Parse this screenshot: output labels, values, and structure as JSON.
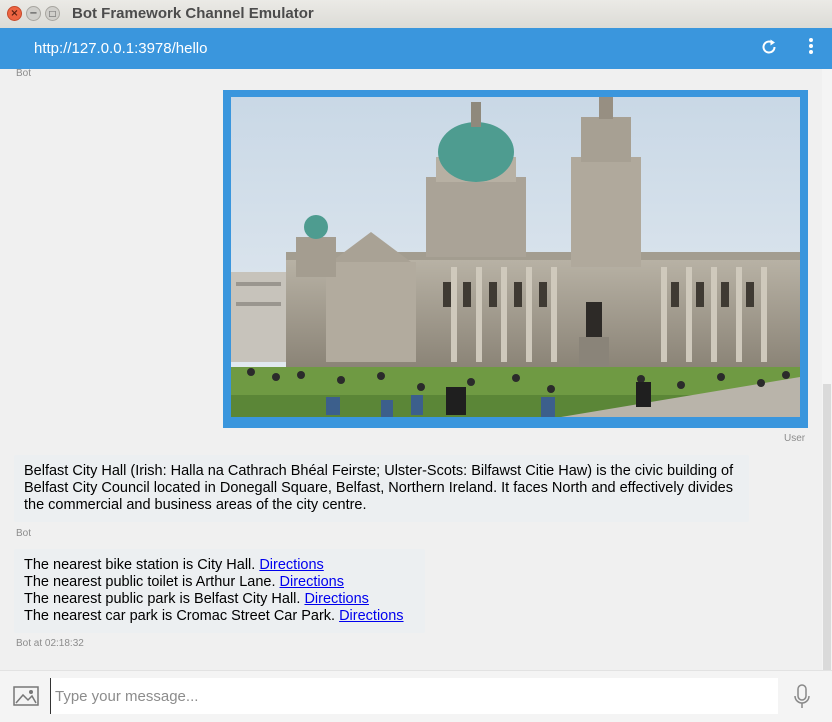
{
  "window": {
    "title": "Bot Framework Channel Emulator"
  },
  "address_bar": {
    "url": "http://127.0.0.1:3978/hello",
    "refresh_icon": "refresh-icon",
    "menu_icon": "kebab-menu-icon"
  },
  "chat": {
    "messages": [
      {
        "from": "bot",
        "label": "Bot"
      },
      {
        "from": "user",
        "type": "image",
        "label": "User"
      },
      {
        "from": "bot",
        "label": "Bot",
        "text": "Belfast City Hall (Irish: Halla na Cathrach Bhéal Feirste; Ulster-Scots: Bilfawst Citie Haw) is the civic building of Belfast City Council located in Donegall Square, Belfast, Northern Ireland. It faces North and effectively divides the commercial and business areas of the city centre."
      },
      {
        "from": "bot",
        "label": "Bot at 02:18:32",
        "lines": [
          {
            "text": "The nearest bike station is City Hall. ",
            "link": "Directions"
          },
          {
            "text": "The nearest public toilet is Arthur Lane. ",
            "link": "Directions"
          },
          {
            "text": "The nearest public park is Belfast City Hall. ",
            "link": "Directions"
          },
          {
            "text": "The nearest car park is Cromac Street Car Park. ",
            "link": "Directions"
          }
        ]
      }
    ]
  },
  "input": {
    "placeholder": "Type your message...",
    "image_icon": "image-upload-icon",
    "mic_icon": "microphone-icon"
  },
  "colors": {
    "accent": "#3a96dd",
    "bubble": "#eceff1",
    "link": "#0000ee",
    "close_button": "#ed6442"
  }
}
